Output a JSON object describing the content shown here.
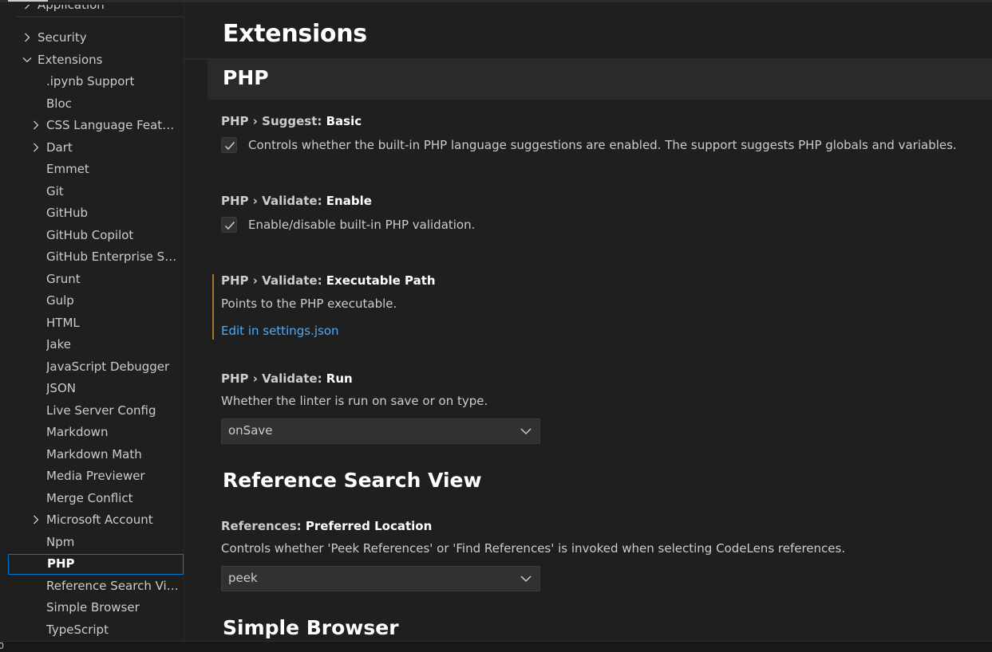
{
  "bottom_status": "0",
  "sidebar": {
    "items": [
      {
        "label": "Application",
        "level": 1,
        "chevron": "right"
      },
      {
        "label": "Security",
        "level": 1,
        "chevron": "right"
      },
      {
        "label": "Extensions",
        "level": 1,
        "chevron": "down"
      },
      {
        "label": ".ipynb Support",
        "level": 2,
        "chevron": ""
      },
      {
        "label": "Bloc",
        "level": 2,
        "chevron": ""
      },
      {
        "label": "CSS Language Features",
        "level": 2,
        "chevron": "right"
      },
      {
        "label": "Dart",
        "level": 2,
        "chevron": "right"
      },
      {
        "label": "Emmet",
        "level": 2,
        "chevron": ""
      },
      {
        "label": "Git",
        "level": 2,
        "chevron": ""
      },
      {
        "label": "GitHub",
        "level": 2,
        "chevron": ""
      },
      {
        "label": "GitHub Copilot",
        "level": 2,
        "chevron": ""
      },
      {
        "label": "GitHub Enterprise Server Authentication Provider",
        "level": 2,
        "chevron": ""
      },
      {
        "label": "Grunt",
        "level": 2,
        "chevron": ""
      },
      {
        "label": "Gulp",
        "level": 2,
        "chevron": ""
      },
      {
        "label": "HTML",
        "level": 2,
        "chevron": ""
      },
      {
        "label": "Jake",
        "level": 2,
        "chevron": ""
      },
      {
        "label": "JavaScript Debugger",
        "level": 2,
        "chevron": ""
      },
      {
        "label": "JSON",
        "level": 2,
        "chevron": ""
      },
      {
        "label": "Live Server Config",
        "level": 2,
        "chevron": ""
      },
      {
        "label": "Markdown",
        "level": 2,
        "chevron": ""
      },
      {
        "label": "Markdown Math",
        "level": 2,
        "chevron": ""
      },
      {
        "label": "Media Previewer",
        "level": 2,
        "chevron": ""
      },
      {
        "label": "Merge Conflict",
        "level": 2,
        "chevron": ""
      },
      {
        "label": "Microsoft Account",
        "level": 2,
        "chevron": "right"
      },
      {
        "label": "Npm",
        "level": 2,
        "chevron": ""
      },
      {
        "label": "PHP",
        "level": 2,
        "chevron": "",
        "selected": true
      },
      {
        "label": "Reference Search View",
        "level": 2,
        "chevron": ""
      },
      {
        "label": "Simple Browser",
        "level": 2,
        "chevron": ""
      },
      {
        "label": "TypeScript",
        "level": 2,
        "chevron": ""
      }
    ]
  },
  "main": {
    "page_title": "Extensions",
    "section_title": "PHP",
    "settings": {
      "suggest_basic": {
        "category": "PHP › Suggest: ",
        "key": "Basic",
        "description": "Controls whether the built-in PHP language suggestions are enabled. The support suggests PHP globals and variables.",
        "checked": true
      },
      "validate_enable": {
        "category": "PHP › Validate: ",
        "key": "Enable",
        "description": "Enable/disable built-in PHP validation.",
        "checked": true
      },
      "validate_executable_path": {
        "category": "PHP › Validate: ",
        "key": "Executable Path",
        "description": "Points to the PHP executable.",
        "link": "Edit in settings.json"
      },
      "validate_run": {
        "category": "PHP › Validate: ",
        "key": "Run",
        "description": "Whether the linter is run on save or on type.",
        "value": "onSave"
      },
      "references_preferred_location": {
        "category": "References: ",
        "key": "Preferred Location",
        "description": "Controls whether 'Peek References' or 'Find References' is invoked when selecting CodeLens references.",
        "value": "peek"
      }
    },
    "group_reference_search_view": "Reference Search View",
    "group_simple_browser": "Simple Browser"
  },
  "colors": {
    "background": "#1f1f1f",
    "focus_border": "#0078d4",
    "link": "#4daafc",
    "modified_indicator": "#a37b2c"
  },
  "icons": {
    "tree_chevron_right": "chevron-right-icon",
    "tree_chevron_down": "chevron-down-icon",
    "checkbox_check": "check-icon",
    "select_arrow": "chevron-down-icon"
  }
}
